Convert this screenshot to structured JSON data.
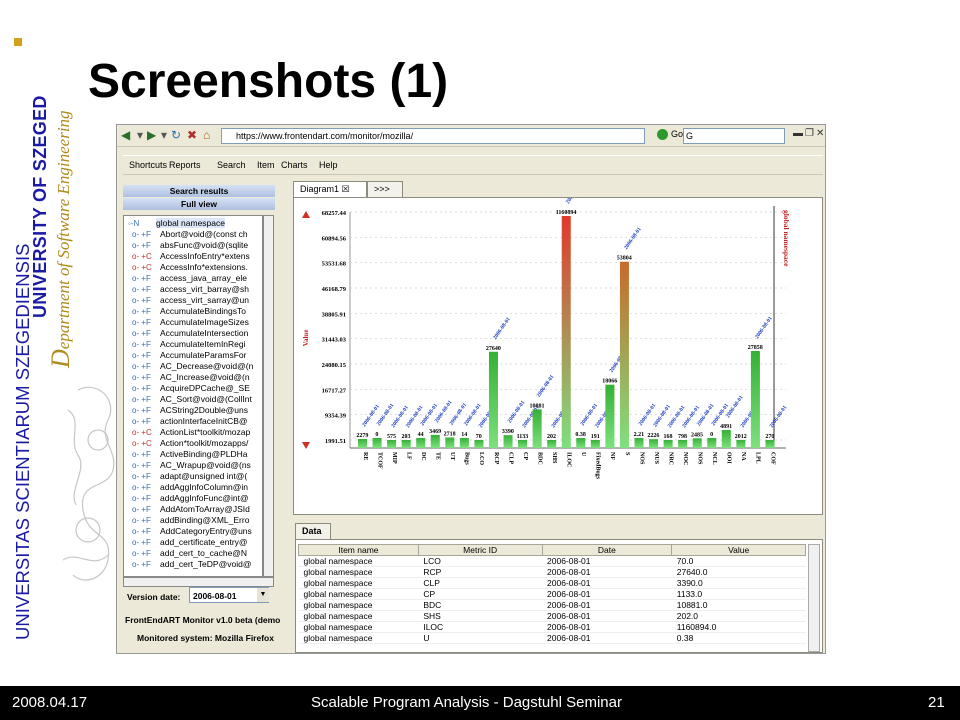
{
  "sidebar": {
    "latin": "UNIVERSITAS SCIENTIARUM SZEGEDIENSIS",
    "english": "UNIVERSITY OF SZEGED",
    "dept_initial": "D",
    "dept_rest": "epartment of Software Engineering"
  },
  "slide": {
    "title": "Screenshots (1)",
    "footer_date": "2008.04.17",
    "footer_title": "Scalable Program Analysis - Dagstuhl Seminar",
    "page": "21"
  },
  "browser": {
    "url": "https://www.frontendart.com/monitor/mozilla/",
    "go_label": "Go",
    "search_value": "G"
  },
  "app": {
    "menu": [
      "Shortcuts",
      "Reports",
      "Search",
      "Item",
      "Charts",
      "Help"
    ],
    "search_results": "Search results",
    "full_view": "Full view",
    "tree_root": "global namespace",
    "tree_items": [
      {
        "icon": "+F",
        "label": "Abort@void@(const ch"
      },
      {
        "icon": "+F",
        "label": "absFunc@void@(sqlite"
      },
      {
        "icon": "+C",
        "label": "AccessInfoEntry*extens"
      },
      {
        "icon": "+C",
        "label": "AccessInfo*extensions."
      },
      {
        "icon": "+F",
        "label": "access_java_array_ele"
      },
      {
        "icon": "+F",
        "label": "access_virt_barray@sh"
      },
      {
        "icon": "+F",
        "label": "access_virt_sarray@un"
      },
      {
        "icon": "+F",
        "label": "AccumulateBindingsTo"
      },
      {
        "icon": "+F",
        "label": "AccumulateImageSizes"
      },
      {
        "icon": "+F",
        "label": "AccumulateIntersection"
      },
      {
        "icon": "+F",
        "label": "AccumulateItemInRegi"
      },
      {
        "icon": "+F",
        "label": "AccumulateParamsFor"
      },
      {
        "icon": "+F",
        "label": "AC_Decrease@void@(n"
      },
      {
        "icon": "+F",
        "label": "AC_Increase@void@(n"
      },
      {
        "icon": "+F",
        "label": "AcquireDPCache@_SE"
      },
      {
        "icon": "+F",
        "label": "AC_Sort@void@(CollInt"
      },
      {
        "icon": "+F",
        "label": "ACString2Double@uns"
      },
      {
        "icon": "+F",
        "label": "actionInterfaceInitCB@"
      },
      {
        "icon": "+C",
        "label": "ActionList*toolkit/mozap"
      },
      {
        "icon": "+C",
        "label": "Action*toolkit/mozapps/"
      },
      {
        "icon": "+F",
        "label": "ActiveBinding@PLDHa"
      },
      {
        "icon": "+F",
        "label": "AC_Wrapup@void@(ns"
      },
      {
        "icon": "+F",
        "label": "adapt@unsigned int@("
      },
      {
        "icon": "+F",
        "label": "addAggInfoColumn@in"
      },
      {
        "icon": "+F",
        "label": "addAggInfoFunc@int@"
      },
      {
        "icon": "+F",
        "label": "AddAtomToArray@JSId"
      },
      {
        "icon": "+F",
        "label": "addBinding@XML_Erro"
      },
      {
        "icon": "+F",
        "label": "AddCategoryEntry@uns"
      },
      {
        "icon": "+F",
        "label": "add_certificate_entry@"
      },
      {
        "icon": "+F",
        "label": "add_cert_to_cache@N"
      },
      {
        "icon": "+F",
        "label": "add_cert_TeDP@void@"
      }
    ],
    "version_label": "Version date:",
    "version_date": "2006-08-01",
    "version_info": "FrontEndART Monitor v1.0 beta (demo",
    "monitored": "Monitored system: Mozilla Firefox",
    "tab_diagram": "Diagram1",
    "tab_more": ">>>",
    "data_tab": "Data",
    "table": {
      "headers": [
        "Item name",
        "Metric ID",
        "Date",
        "Value"
      ],
      "rows": [
        [
          "global namespace",
          "LCO",
          "2006-08-01",
          "70.0"
        ],
        [
          "global namespace",
          "RCP",
          "2006-08-01",
          "27640.0"
        ],
        [
          "global namespace",
          "CLP",
          "2006-08-01",
          "3390.0"
        ],
        [
          "global namespace",
          "CP",
          "2006-08-01",
          "1133.0"
        ],
        [
          "global namespace",
          "BDC",
          "2006-08-01",
          "10881.0"
        ],
        [
          "global namespace",
          "SHS",
          "2006-08-01",
          "202.0"
        ],
        [
          "global namespace",
          "ILOC",
          "2006-08-01",
          "1160894.0"
        ],
        [
          "global namespace",
          "U",
          "2006-08-01",
          "0.38"
        ]
      ]
    }
  },
  "chart_data": {
    "type": "bar",
    "ylabel": "Value",
    "series_label": "global namespace",
    "bar_date": "2006-08-01",
    "yticks": [
      "68257.44",
      "60894.56",
      "53531.68",
      "46168.79",
      "38805.91",
      "31443.03",
      "24080.15",
      "16717.27",
      "9354.39",
      "1991.51"
    ],
    "categories": [
      "RE",
      "TCOF",
      "MIP",
      "LF",
      "DC",
      "TE",
      "UT",
      "Bugs",
      "LCO",
      "RCP",
      "CLP",
      "CP",
      "BDC",
      "SHS",
      "ILOC",
      "U",
      "FixedBugs",
      "NF",
      "S",
      "NOS",
      "NUS",
      "NRC",
      "NOC",
      "NOS",
      "NCL",
      "OOI",
      "NA",
      "LPL",
      "COF"
    ],
    "values": [
      2279,
      0,
      575,
      203,
      44,
      3469,
      2718,
      14,
      70,
      27640,
      3390,
      1133,
      10881,
      202,
      1160894,
      0.38,
      191,
      18066,
      53804,
      2.21,
      2226,
      168,
      798,
      2485,
      0,
      4891,
      2012,
      27858,
      270
    ],
    "labels": [
      "2279",
      "0",
      "575",
      "203",
      "44",
      "3469",
      "2718",
      "14",
      "70",
      "27640",
      "3390",
      "1133",
      "10881",
      "202",
      "1160894",
      "0.38",
      "191",
      "18066",
      "53804",
      "2.21",
      "2226",
      "168",
      "798",
      "2485",
      "0",
      "4891",
      "2012",
      "27858",
      "270"
    ],
    "colors": {
      "normal": "#35b035",
      "high": "#e03a2a",
      "mid": "#c76a2a"
    }
  }
}
